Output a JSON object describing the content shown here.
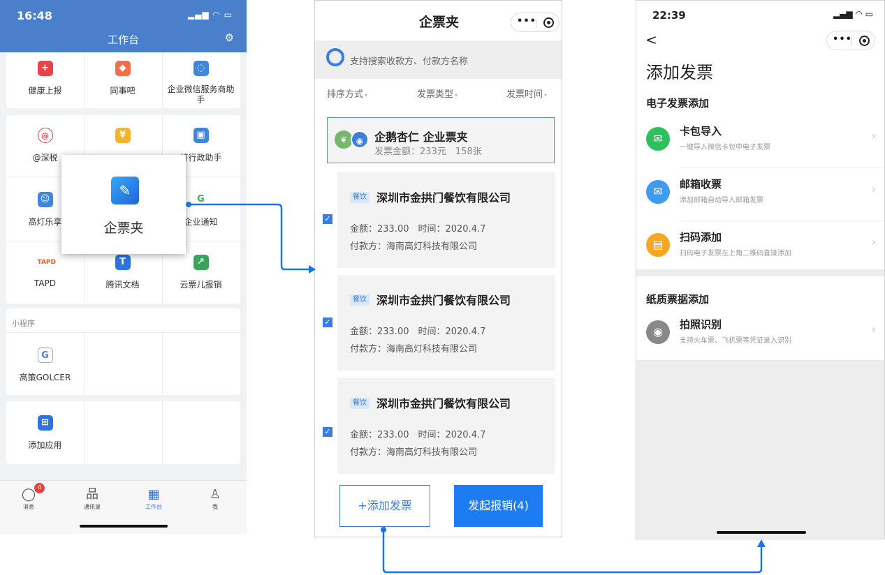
{
  "phone1": {
    "status_time": "16:48",
    "title": "工作台",
    "apps_row1": [
      "健康上报",
      "同事吧",
      "企业微信服务商助手"
    ],
    "apps_row2": [
      "@深税",
      "",
      "灯行政助手"
    ],
    "apps_row3": [
      "高灯乐享",
      "",
      "企业通知"
    ],
    "apps_row4": [
      "TAPD",
      "腾讯文档",
      "云票儿报销"
    ],
    "mini_section": "小程序",
    "mini_app": "高策GOLCER",
    "add_app": "添加应用",
    "tabs": [
      "消息",
      "通讯录",
      "工作台",
      "我"
    ],
    "message_badge": "4",
    "popup_label": "企票夹"
  },
  "phone2": {
    "title": "企票夹",
    "search_placeholder": "支持搜索收款方、付款方名称",
    "filters": [
      "排序方式",
      "发票类型",
      "发票时间"
    ],
    "summary_title": "企鹅杏仁 企业票夹",
    "summary_sub": "发票金额：233元　158张",
    "invoices": [
      {
        "tag": "餐饮",
        "company": "深圳市金拱门餐饮有限公司",
        "line1": "金额：233.00　时间：2020.4.7",
        "line2": "付款方：海南高灯科技有限公司"
      },
      {
        "tag": "餐饮",
        "company": "深圳市金拱门餐饮有限公司",
        "line1": "金额：233.00　时间：2020.4.7",
        "line2": "付款方：海南高灯科技有限公司"
      },
      {
        "tag": "餐饮",
        "company": "深圳市金拱门餐饮有限公司",
        "line1": "金额：233.00　时间：2020.4.7",
        "line2": "付款方：海南高灯科技有限公司"
      }
    ],
    "add_button": "+添加发票",
    "submit_button": "发起报销(4)"
  },
  "phone3": {
    "status_time": "22:39",
    "back": "<",
    "title": "添加发票",
    "electronic_section": "电子发票添加",
    "rows": [
      {
        "title": "卡包导入",
        "sub": "一键导入微信卡包中电子发票"
      },
      {
        "title": "邮箱收票",
        "sub": "添加邮箱自动导入邮箱发票"
      },
      {
        "title": "扫码添加",
        "sub": "扫码电子发票左上角二维码直接添加"
      }
    ],
    "paper_section": "纸质票据添加",
    "photo": {
      "title": "拍照识别",
      "sub": "支持火车票、飞机票等凭证录入识别"
    }
  },
  "colors": {
    "accent": "#1e7cf2",
    "header": "#4a7fcc",
    "arrow": "#1a73e8"
  }
}
